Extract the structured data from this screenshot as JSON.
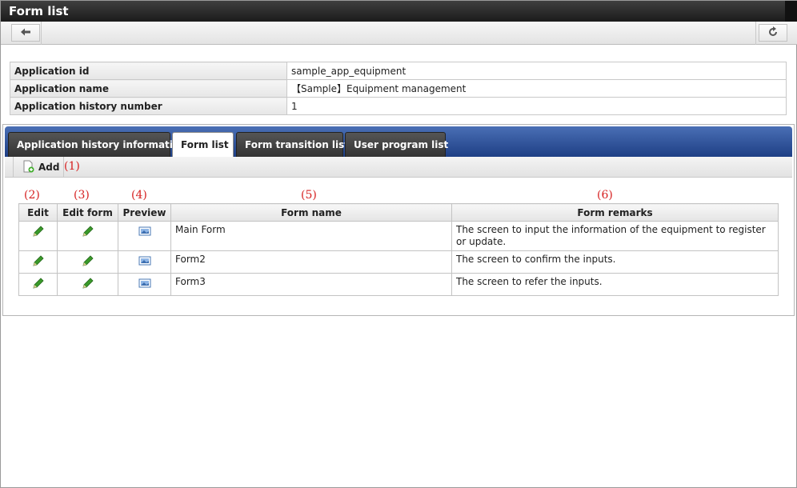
{
  "window": {
    "title": "Form list"
  },
  "toolbar": {
    "back_icon": "back-arrow-icon",
    "reload_icon": "reload-icon"
  },
  "info": {
    "rows": [
      {
        "label": "Application id",
        "value": "sample_app_equipment"
      },
      {
        "label": "Application name",
        "value": "【Sample】Equipment management"
      },
      {
        "label": "Application history number",
        "value": "1"
      }
    ]
  },
  "tabs": [
    {
      "label": "Application history information",
      "active": false
    },
    {
      "label": "Form list",
      "active": true
    },
    {
      "label": "Form transition list",
      "active": false
    },
    {
      "label": "User program list",
      "active": false
    }
  ],
  "actions": {
    "add_label": "Add",
    "add_icon": "add-page-icon"
  },
  "annotations": [
    "(1)",
    "(2)",
    "(3)",
    "(4)",
    "(5)",
    "(6)"
  ],
  "grid": {
    "columns": [
      "Edit",
      "Edit form",
      "Preview",
      "Form name",
      "Form remarks"
    ],
    "rows": [
      {
        "form_name": "Main Form",
        "remarks": "The screen to input the information of the equipment to register or update."
      },
      {
        "form_name": "Form2",
        "remarks": "The screen to confirm the inputs."
      },
      {
        "form_name": "Form3",
        "remarks": "The screen to refer the inputs."
      }
    ],
    "edit_icon": "pencil-icon",
    "preview_icon": "image-icon"
  },
  "colors": {
    "tab_bar": "#2f55a0",
    "annotation": "#d62020",
    "pencil": "#3a9a2a"
  }
}
